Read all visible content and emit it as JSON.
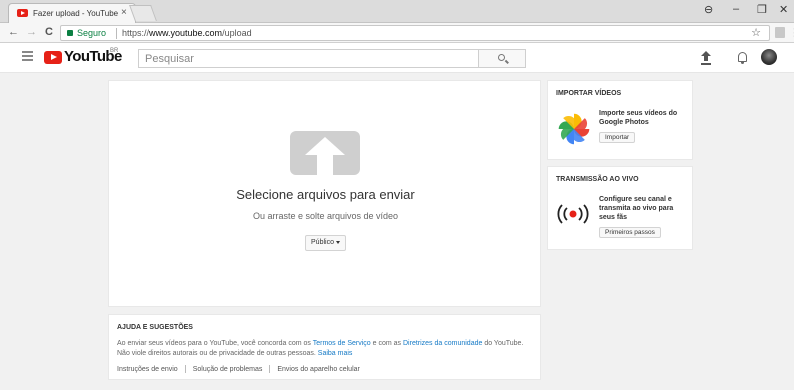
{
  "browser": {
    "tab_title": "Fazer upload - YouTube",
    "tab_close": "×",
    "secure_label": "Seguro",
    "url_scheme": "https://",
    "url_host": "www.youtube.com",
    "url_path": "/upload",
    "controls": {
      "back": "←",
      "forward": "→",
      "reload": "C",
      "star": "☆",
      "menu": "⋮",
      "minimize": "–",
      "restore": "❐",
      "close": "✕",
      "profile": "⊖"
    }
  },
  "masthead": {
    "logo_text": "YouTube",
    "country_code": "BR",
    "search_placeholder": "Pesquisar"
  },
  "upload": {
    "title": "Selecione arquivos para enviar",
    "drag_hint": "Ou arraste e solte arquivos de vídeo",
    "privacy_label": "Público"
  },
  "help": {
    "title": "AJUDA E SUGESTÕES",
    "line1_pre": "Ao enviar seus vídeos para o YouTube, você concorda com os ",
    "line1_link1": "Termos de Serviço",
    "line1_mid": " e com as ",
    "line1_link2": "Diretrizes da comunidade",
    "line1_post": " do YouTube.",
    "line2_pre": "Não viole direitos autorais ou de privacidade de outras pessoas. ",
    "line2_link": "Saiba mais",
    "links": [
      "Instruções de envio",
      "Solução de problemas",
      "Envios do aparelho celular"
    ]
  },
  "import_card": {
    "title": "IMPORTAR VÍDEOS",
    "description": "Importe seus vídeos do Google Photos",
    "button": "Importar",
    "icon": "google-photos-pinwheel"
  },
  "live_card": {
    "title": "TRANSMISSÃO AO VIVO",
    "description": "Configure seu canal e transmita ao vivo para seus fãs",
    "button": "Primeiros passos",
    "icon": "live-broadcast"
  },
  "colors": {
    "brand_red": "#e62117",
    "link_blue": "#167ac6",
    "secure_green": "#0b8043"
  }
}
